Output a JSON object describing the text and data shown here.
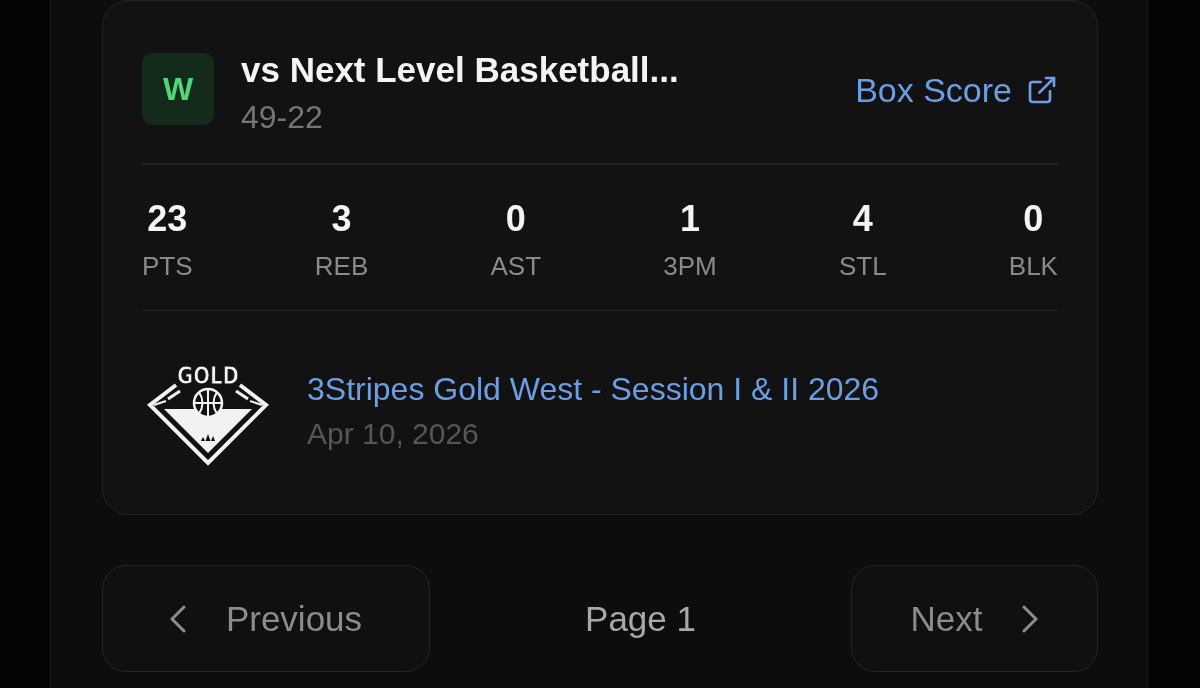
{
  "game": {
    "result": "W",
    "opponent": "vs Next Level Basketball...",
    "score": "49-22",
    "link": "Box Score"
  },
  "stats": [
    {
      "value": "23",
      "label": "PTS"
    },
    {
      "value": "3",
      "label": "REB"
    },
    {
      "value": "0",
      "label": "AST"
    },
    {
      "value": "1",
      "label": "3PM"
    },
    {
      "value": "4",
      "label": "STL"
    },
    {
      "value": "0",
      "label": "BLK"
    }
  ],
  "event": {
    "logo_text": "GOLD",
    "name": "3Stripes Gold West - Session I & II 2026",
    "date": "Apr 10, 2026"
  },
  "pagination": {
    "previous": "Previous",
    "page": "Page 1",
    "next": "Next"
  }
}
